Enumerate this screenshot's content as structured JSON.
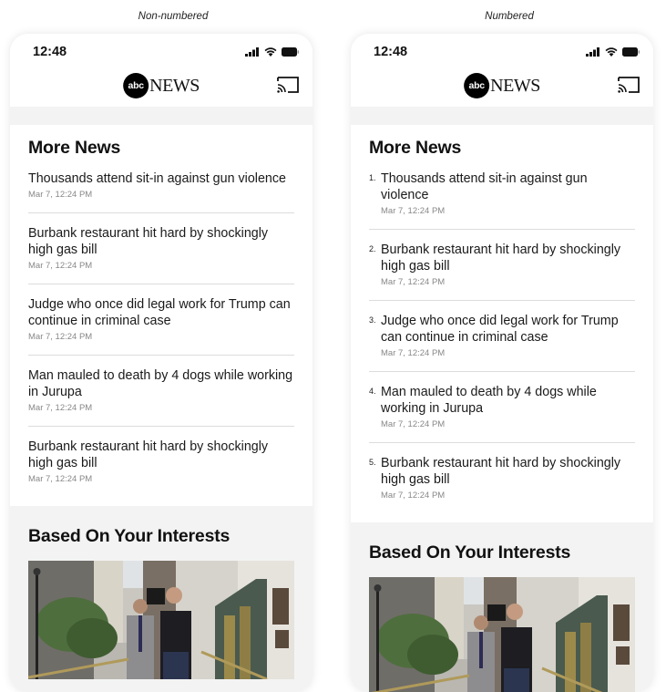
{
  "captions": {
    "left": "Non-numbered",
    "right": "Numbered"
  },
  "status": {
    "time": "12:48",
    "icons": [
      "signal-icon",
      "wifi-icon",
      "battery-icon"
    ]
  },
  "app": {
    "logo_circle": "abc",
    "logo_word": "NEWS",
    "cast_icon": "cast-icon"
  },
  "more_news": {
    "title": "More News",
    "items": [
      {
        "num": "1.",
        "headline": "Thousands attend sit-in against gun violence",
        "timestamp": "Mar 7, 12:24 PM"
      },
      {
        "num": "2.",
        "headline": "Burbank restaurant hit hard by shockingly high gas bill",
        "timestamp": "Mar 7, 12:24 PM"
      },
      {
        "num": "3.",
        "headline": "Judge who once did legal work for Trump can continue in criminal case",
        "timestamp": "Mar 7, 12:24 PM"
      },
      {
        "num": "4.",
        "headline": "Man mauled to death by 4 dogs while working in Jurupa",
        "timestamp": "Mar 7, 12:24 PM"
      },
      {
        "num": "5.",
        "headline": "Burbank restaurant hit hard by shockingly high gas bill",
        "timestamp": "Mar 7, 12:24 PM"
      }
    ]
  },
  "interests": {
    "title": "Based On Your Interests",
    "image_alt": "Two men walking down city steps, one carrying a TV camera"
  }
}
